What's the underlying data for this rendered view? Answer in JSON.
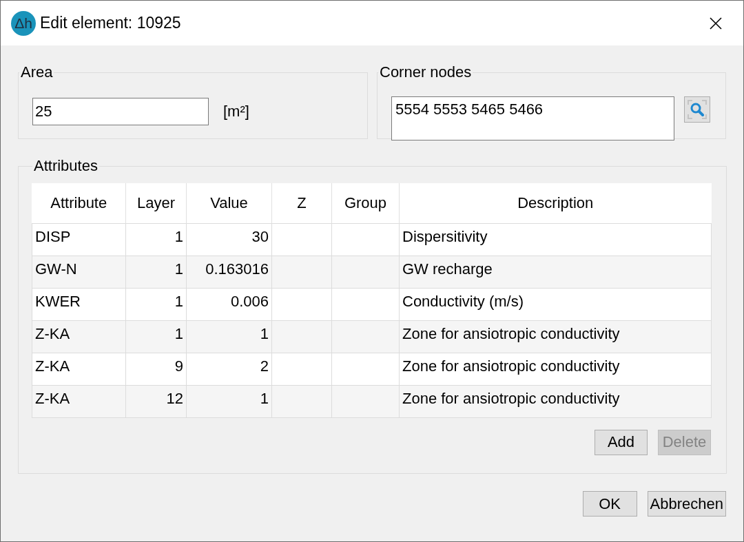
{
  "window": {
    "title": "Edit element: 10925",
    "icon_text": "Δh"
  },
  "area": {
    "label": "Area",
    "value": "25",
    "unit": "[m²]"
  },
  "corner_nodes": {
    "label": "Corner nodes",
    "value": "5554 5553 5465 5466"
  },
  "attributes": {
    "label": "Attributes",
    "columns": [
      {
        "label": "Attribute",
        "kind": "text"
      },
      {
        "label": "Layer",
        "kind": "number"
      },
      {
        "label": "Value",
        "kind": "number"
      },
      {
        "label": "Z",
        "kind": "number"
      },
      {
        "label": "Group",
        "kind": "text"
      },
      {
        "label": "Description",
        "kind": "text"
      }
    ],
    "rows": [
      {
        "cells": [
          "DISP",
          "1",
          "30",
          "",
          "",
          "Dispersitivity"
        ]
      },
      {
        "cells": [
          "GW-N",
          "1",
          "0.163016",
          "",
          "",
          "GW recharge"
        ]
      },
      {
        "cells": [
          "KWER",
          "1",
          "0.006",
          "",
          "",
          "Conductivity (m/s)"
        ]
      },
      {
        "cells": [
          "Z-KA",
          "1",
          "1",
          "",
          "",
          "Zone for ansiotropic conductivity"
        ]
      },
      {
        "cells": [
          "Z-KA",
          "9",
          "2",
          "",
          "",
          "Zone for ansiotropic conductivity"
        ]
      },
      {
        "cells": [
          "Z-KA",
          "12",
          "1",
          "",
          "",
          "Zone for ansiotropic conductivity"
        ]
      }
    ],
    "buttons": [
      {
        "label": "Add",
        "disabled": false
      },
      {
        "label": "Delete",
        "disabled": true
      }
    ]
  },
  "buttons": [
    {
      "label": "OK",
      "disabled": false
    },
    {
      "label": "Abbrechen",
      "disabled": false
    }
  ]
}
